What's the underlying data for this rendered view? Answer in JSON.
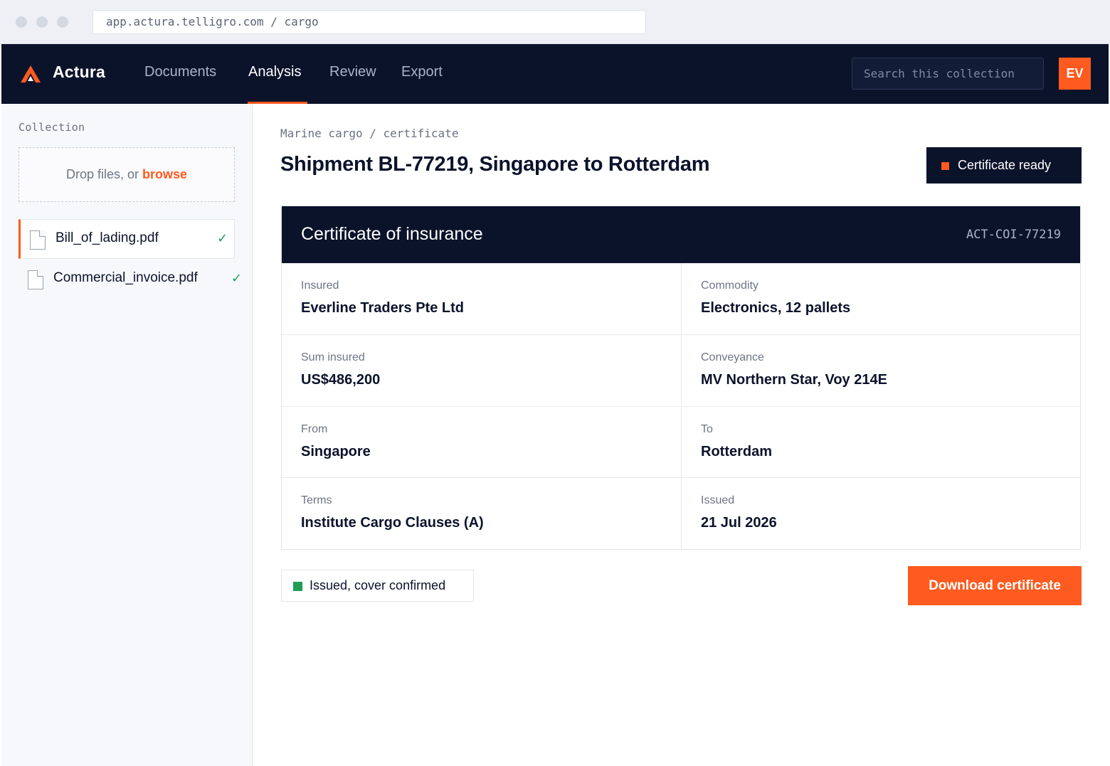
{
  "browser": {
    "url": "app.actura.telligro.com / cargo"
  },
  "nav": {
    "brand": "Actura",
    "links": [
      "Documents",
      "Analysis",
      "Review",
      "Export"
    ],
    "active_link": "Analysis",
    "search_placeholder": "Search this collection",
    "avatar_initials": "EV",
    "accent_color": "#ff5a1f",
    "bg_color": "#0b132b"
  },
  "sidebar": {
    "title": "Collection",
    "dropzone_text": "Drop files, or ",
    "dropzone_link": "browse",
    "files": [
      {
        "name": "Bill_of_lading.pdf",
        "status": "✓"
      },
      {
        "name": "Commercial_invoice.pdf",
        "status": "✓"
      }
    ]
  },
  "main": {
    "breadcrumb": "Marine cargo / certificate",
    "title": "Shipment BL-77219, Singapore to Rotterdam",
    "badge": "Certificate ready",
    "card": {
      "title": "Certificate of insurance",
      "id": "ACT-COI-77219",
      "fields": [
        {
          "label": "Insured",
          "value": "Everline Traders Pte Ltd"
        },
        {
          "label": "Commodity",
          "value": "Electronics, 12 pallets"
        },
        {
          "label": "Sum insured",
          "value": "US$486,200"
        },
        {
          "label": "Conveyance",
          "value": "MV Northern Star, Voy 214E"
        },
        {
          "label": "From",
          "value": "Singapore"
        },
        {
          "label": "To",
          "value": "Rotterdam"
        },
        {
          "label": "Terms",
          "value": "Institute Cargo Clauses (A)"
        },
        {
          "label": "Issued",
          "value": "21 Jul 2026"
        }
      ]
    },
    "status": "Issued, cover confirmed",
    "status_color": "#1f9d55",
    "download_label": "Download certificate"
  }
}
